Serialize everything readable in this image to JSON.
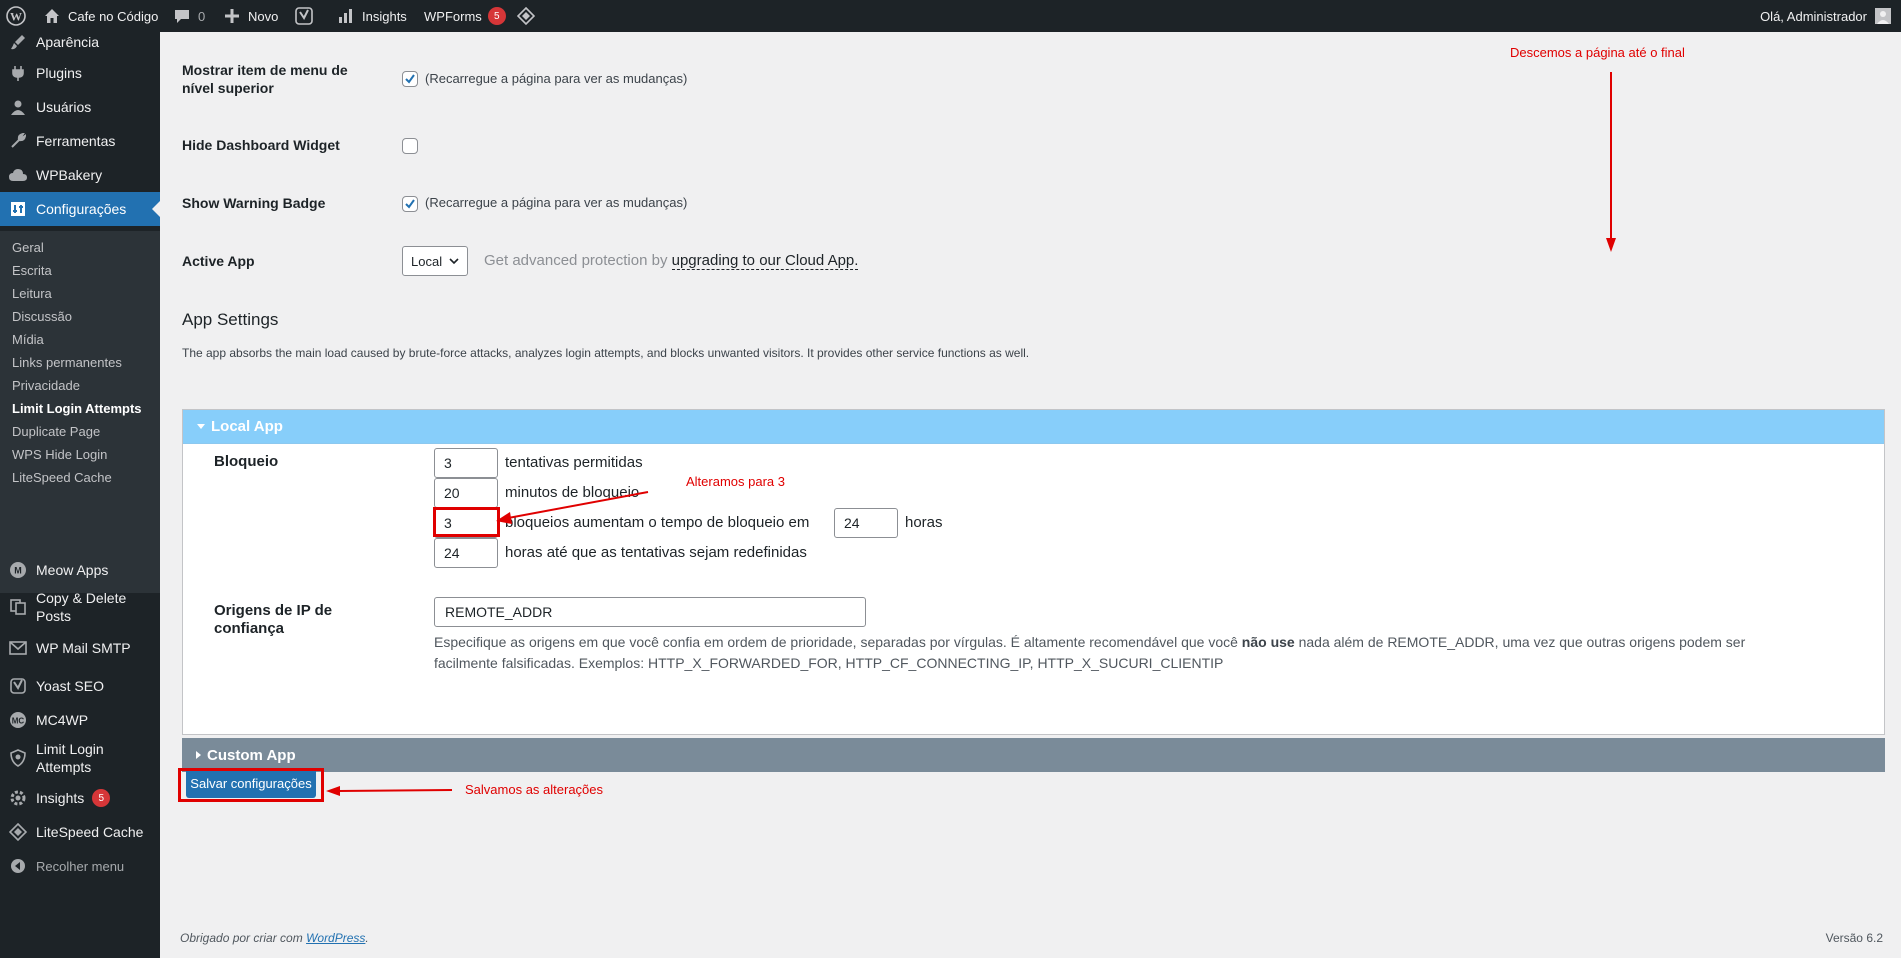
{
  "adminbar": {
    "site_name": "Cafe no Código",
    "comments_count": "0",
    "new_label": "Novo",
    "insights_label": "Insights",
    "wpforms_label": "WPForms",
    "wpforms_badge": "5",
    "greeting": "Olá, Administrador"
  },
  "sidebar": {
    "items": [
      {
        "label": "Aparência"
      },
      {
        "label": "Plugins"
      },
      {
        "label": "Usuários"
      },
      {
        "label": "Ferramentas"
      },
      {
        "label": "WPBakery"
      },
      {
        "label": "Configurações"
      },
      {
        "label": "Meow Apps"
      },
      {
        "label": "Copy & Delete Posts"
      },
      {
        "label": "WP Mail SMTP"
      },
      {
        "label": "Yoast SEO"
      },
      {
        "label": "MC4WP"
      },
      {
        "label": "Limit Login Attempts"
      },
      {
        "label": "Insights",
        "badge": "5"
      },
      {
        "label": "LiteSpeed Cache"
      },
      {
        "label": "Recolher menu"
      }
    ],
    "submenu": [
      {
        "label": "Geral"
      },
      {
        "label": "Escrita"
      },
      {
        "label": "Leitura"
      },
      {
        "label": "Discussão"
      },
      {
        "label": "Mídia"
      },
      {
        "label": "Links permanentes"
      },
      {
        "label": "Privacidade"
      },
      {
        "label": "Limit Login Attempts"
      },
      {
        "label": "Duplicate Page"
      },
      {
        "label": "WPS Hide Login"
      },
      {
        "label": "LiteSpeed Cache"
      }
    ]
  },
  "settings": {
    "top_menu_label": "Mostrar item de menu de nível superior",
    "top_menu_hint": "(Recarregue a página para ver as mudanças)",
    "hide_widget_label": "Hide Dashboard Widget",
    "warning_badge_label": "Show Warning Badge",
    "warning_badge_hint": "(Recarregue a página para ver as mudanças)",
    "active_app_label": "Active App",
    "active_app_value": "Local",
    "active_app_hint_prefix": "Get advanced protection by",
    "active_app_hint_link": "upgrading to our Cloud App."
  },
  "app_settings": {
    "title": "App Settings",
    "description": "The app absorbs the main load caused by brute-force attacks, analyzes login attempts, and blocks unwanted visitors. It provides other service functions as well.",
    "local_app_title": "Local App",
    "custom_app_title": "Custom App",
    "lockout_label": "Bloqueio",
    "allowed_retries": "3",
    "allowed_retries_text": "tentativas permitidas",
    "lockout_minutes": "20",
    "lockout_minutes_text": "minutos de bloqueio",
    "lockouts_increase": "3",
    "lockouts_increase_text": "bloqueios aumentam o tempo de bloqueio em",
    "increase_hours": "24",
    "increase_hours_unit": "horas",
    "reset_hours": "24",
    "reset_hours_text": "horas até que as tentativas sejam redefinidas",
    "trusted_ip_label": "Origens de IP de confiança",
    "trusted_ip_value": "REMOTE_ADDR",
    "trusted_ip_desc_1": "Especifique as origens em que você confia em ordem de prioridade, separadas por vírgulas. É altamente recomendável que você",
    "trusted_ip_desc_bold": "não use",
    "trusted_ip_desc_2": "nada além de REMOTE_ADDR, uma vez que outras origens podem ser facilmente falsificadas. Exemplos: HTTP_X_FORWARDED_FOR, HTTP_CF_CONNECTING_IP, HTTP_X_SUCURI_CLIENTIP"
  },
  "save_button": "Salvar configurações",
  "annotations": {
    "scroll_note": "Descemos a página até o final",
    "changed_note": "Alteramos para 3",
    "saved_note": "Salvamos as alterações"
  },
  "footer": {
    "thanks_prefix": "Obrigado por criar com",
    "thanks_link": "WordPress",
    "thanks_suffix": ".",
    "version": "Versão 6.2"
  },
  "colors": {
    "admin_dark": "#1d2327",
    "accent": "#2271b1",
    "local_app_header": "#87cefa",
    "custom_app_header": "#7a8b99",
    "annotation_red": "#e00000",
    "badge": "#d63638"
  }
}
